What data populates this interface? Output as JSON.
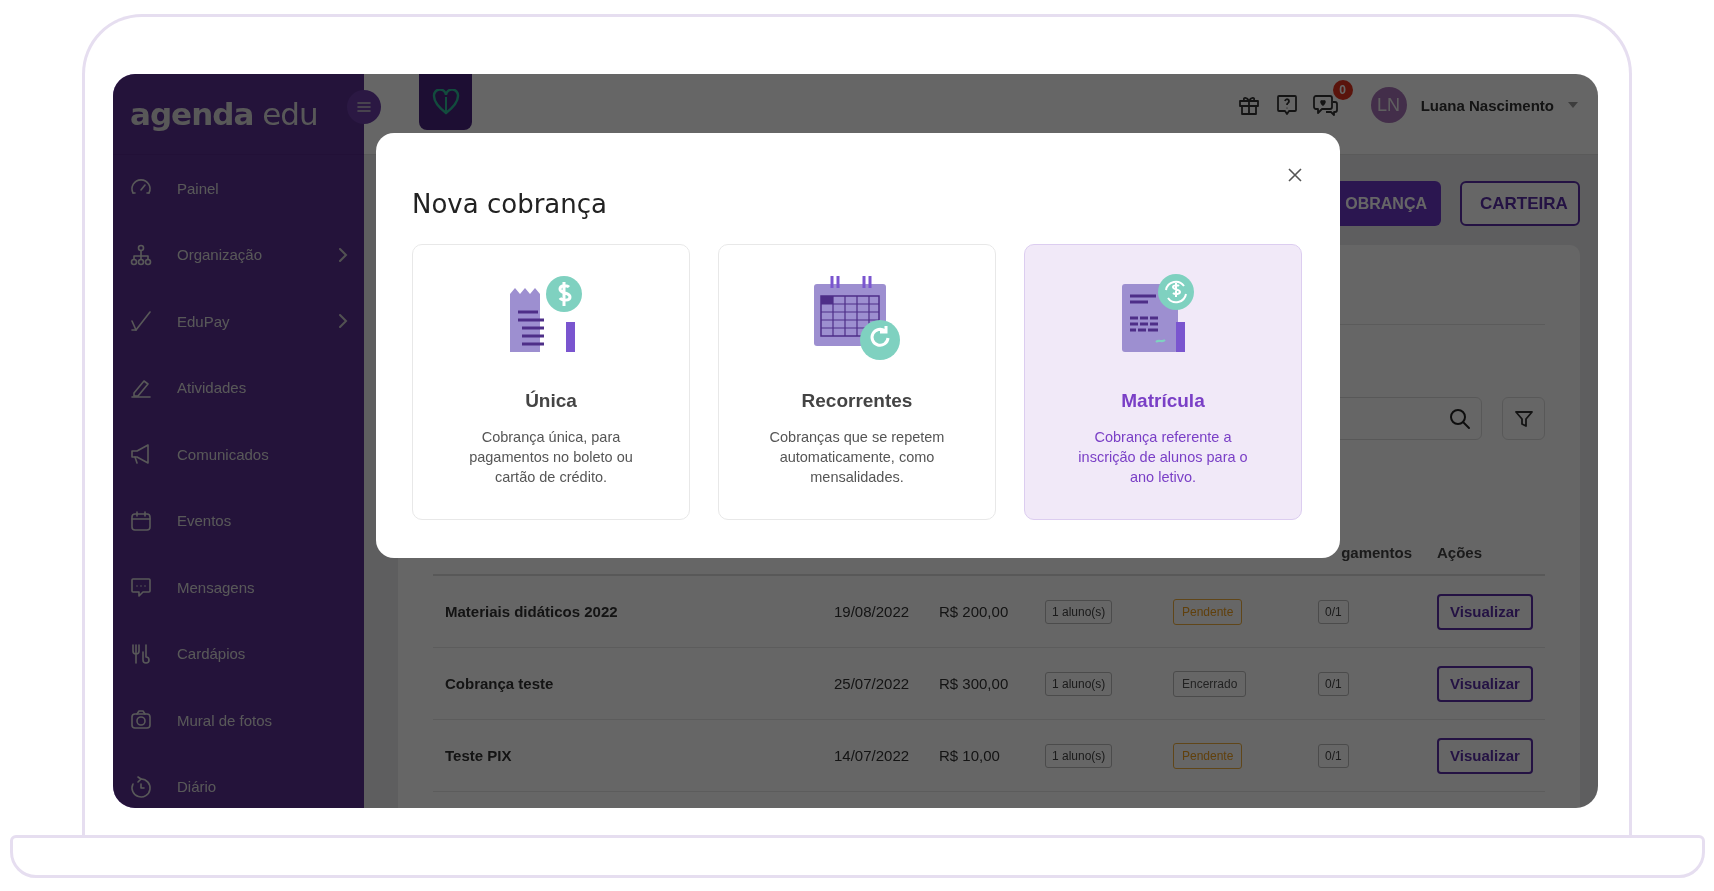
{
  "sidebar": {
    "logo": {
      "bold": "agenda",
      "light": "edu"
    },
    "items": [
      {
        "label": "Painel",
        "has_submenu": false
      },
      {
        "label": "Organização",
        "has_submenu": true
      },
      {
        "label": "EduPay",
        "has_submenu": true
      },
      {
        "label": "Atividades",
        "has_submenu": false
      },
      {
        "label": "Comunicados",
        "has_submenu": false
      },
      {
        "label": "Eventos",
        "has_submenu": false
      },
      {
        "label": "Mensagens",
        "has_submenu": false
      },
      {
        "label": "Cardápios",
        "has_submenu": false
      },
      {
        "label": "Mural de fotos",
        "has_submenu": false
      },
      {
        "label": "Diário",
        "has_submenu": false
      }
    ]
  },
  "topbar": {
    "notification_count": "0",
    "user": {
      "initials": "LN",
      "name": "Luana Nascimento"
    }
  },
  "actions": [
    {
      "label": "OBRANÇA",
      "kind": "primary"
    },
    {
      "label": "CARTEIRA",
      "kind": "outline"
    }
  ],
  "table": {
    "columns": [
      {
        "label": "gamentos",
        "kind": "payments"
      },
      {
        "label": "Ações",
        "kind": "actions"
      }
    ],
    "rows": [
      {
        "name": "Materiais didáticos 2022",
        "date": "19/08/2022",
        "amount": "R$ 200,00",
        "students": "1 aluno(s)",
        "status": {
          "label": "Pendente",
          "kind": "pending"
        },
        "payments": "0/1",
        "action": "Visualizar"
      },
      {
        "name": "Cobrança teste",
        "date": "25/07/2022",
        "amount": "R$ 300,00",
        "students": "1 aluno(s)",
        "status": {
          "label": "Encerrado",
          "kind": "closed"
        },
        "payments": "0/1",
        "action": "Visualizar"
      },
      {
        "name": "Teste PIX",
        "date": "14/07/2022",
        "amount": "R$ 10,00",
        "students": "1 aluno(s)",
        "status": {
          "label": "Pendente",
          "kind": "pending"
        },
        "payments": "0/1",
        "action": "Visualizar"
      }
    ]
  },
  "modal": {
    "title": "Nova cobrança",
    "options": [
      {
        "kind": "receipt",
        "title": "Única",
        "description": "Cobrança única, para pagamentos no boleto ou cartão de crédito.",
        "selected": false
      },
      {
        "kind": "calendar",
        "title": "Recorrentes",
        "description": "Cobranças que se repetem automaticamente, como mensalidades.",
        "selected": false
      },
      {
        "kind": "document",
        "title": "Matrícula",
        "description": "Cobrança referente a inscrição de alunos para o ano letivo.",
        "selected": true
      }
    ]
  }
}
